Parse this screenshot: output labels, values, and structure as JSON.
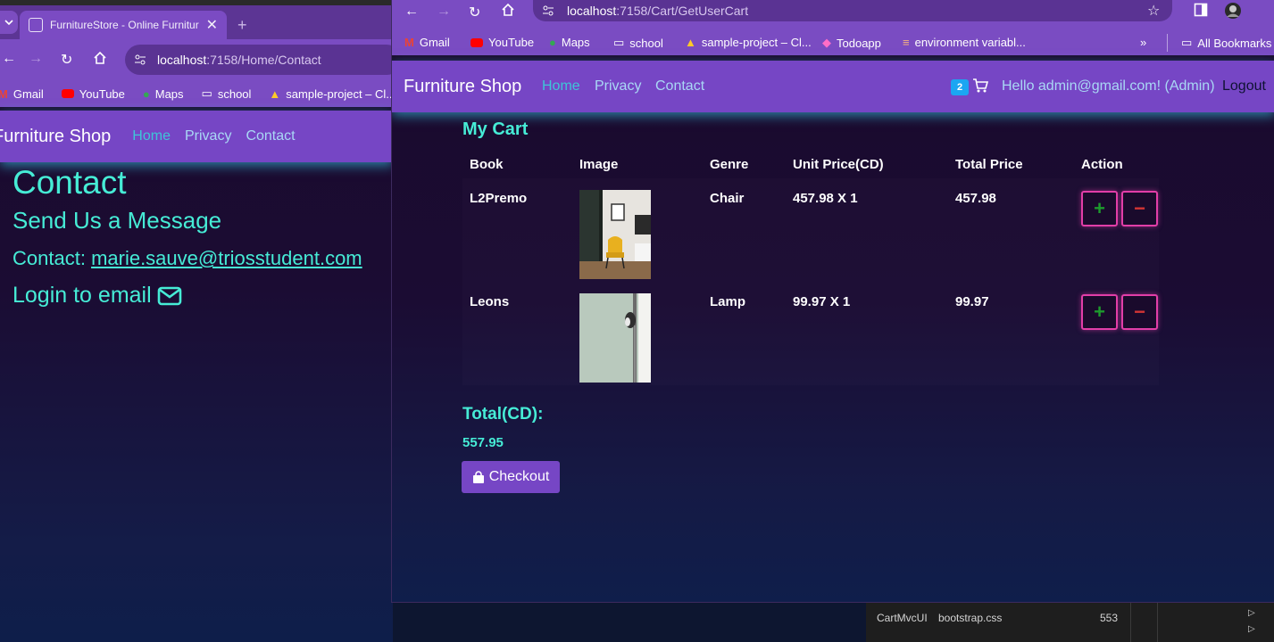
{
  "left_window": {
    "tab_title": "FurnitureStore - Online Furnitur",
    "url_host": "localhost",
    "url_path": ":7158/Home/Contact",
    "bookmarks": [
      "Gmail",
      "YouTube",
      "Maps",
      "school",
      "sample-project – Cl..."
    ],
    "navbar": {
      "brand": "Furniture Shop",
      "links": [
        "Home",
        "Privacy",
        "Contact"
      ]
    },
    "content": {
      "heading": "Contact",
      "subheading": "Send Us a Message",
      "contact_label": "Contact:",
      "contact_email": "marie.sauve@triosstudent.com",
      "login_text": "Login to email"
    }
  },
  "right_window": {
    "url_host": "localhost",
    "url_path": ":7158/Cart/GetUserCart",
    "bookmarks": [
      "Gmail",
      "YouTube",
      "Maps",
      "school",
      "sample-project – Cl...",
      "Todoapp",
      "environment variabl..."
    ],
    "all_bookmarks": "All Bookmarks",
    "navbar": {
      "brand": "Furniture Shop",
      "links": [
        "Home",
        "Privacy",
        "Contact"
      ],
      "cart_count": "2",
      "greeting": "Hello admin@gmail.com! (Admin)",
      "logout": "Logout"
    },
    "cart": {
      "title": "My Cart",
      "columns": [
        "Book",
        "Image",
        "Genre",
        "Unit Price(CD)",
        "Total Price",
        "Action"
      ],
      "rows": [
        {
          "book": "L2Premo",
          "genre": "Chair",
          "unit_price": "457.98 X 1",
          "total": "457.98"
        },
        {
          "book": "Leons",
          "genre": "Lamp",
          "unit_price": "99.97 X 1",
          "total": "99.97"
        }
      ],
      "action_plus": "+",
      "action_minus": "−",
      "total_label": "Total(CD):",
      "total_value": "557.95",
      "checkout_label": "Checkout"
    }
  },
  "ide": {
    "project": "CartMvcUI",
    "file": "bootstrap.css",
    "line": "553"
  },
  "colors": {
    "accent_purple": "#7646c5",
    "teal_text": "#46ecd6",
    "link_blue": "#a9d8f5",
    "badge_blue": "#1ba6f2",
    "btn_border": "#e23ea8"
  }
}
